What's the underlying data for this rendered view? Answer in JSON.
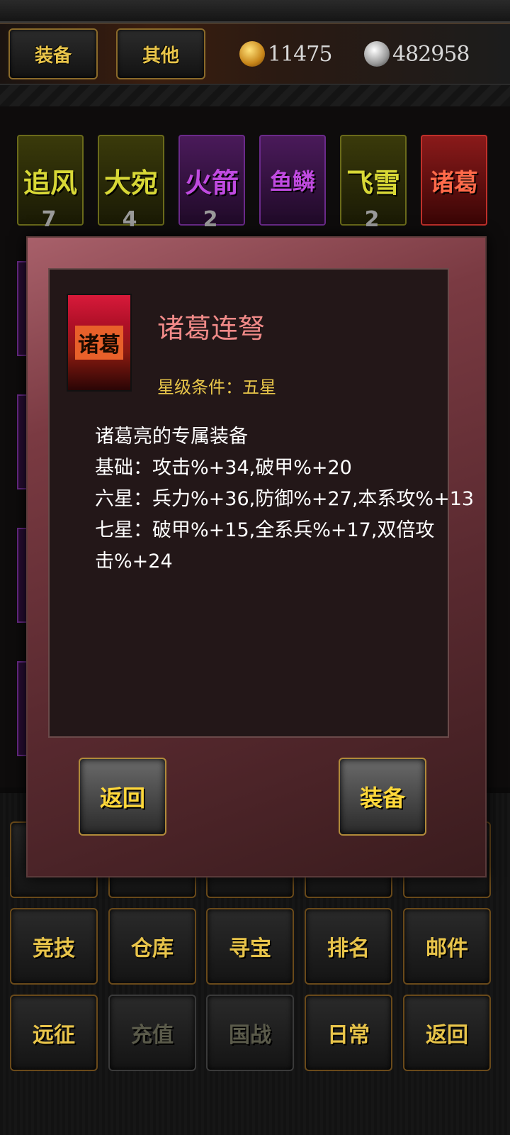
{
  "tabs": {
    "equip": "装备",
    "other": "其他"
  },
  "currency": {
    "gold": "11475",
    "silver": "482958"
  },
  "cards": [
    {
      "label": "追风",
      "count": "7"
    },
    {
      "label": "大宛",
      "count": "4"
    },
    {
      "label": "火箭",
      "count": "2"
    },
    {
      "label": "鱼鳞",
      "count": ""
    },
    {
      "label": "飞雪",
      "count": "2"
    },
    {
      "label": "诸葛",
      "count": ""
    }
  ],
  "modal": {
    "icon_label": "诸葛",
    "name": "诸葛连弩",
    "star_condition": "星级条件：五星",
    "desc": [
      "诸葛亮的专属装备",
      "基础：攻击%+34,破甲%+20",
      "六星：兵力%+36,防御%+27,本系攻%+13",
      "七星：破甲%+15,全系兵%+17,双倍攻击%+24"
    ],
    "back_button": "返回",
    "equip_button": "装备"
  },
  "menu": {
    "row2": [
      "竞技",
      "仓库",
      "寻宝",
      "排名",
      "邮件"
    ],
    "row3": [
      "远征",
      "充值",
      "国战",
      "日常",
      "返回"
    ]
  }
}
